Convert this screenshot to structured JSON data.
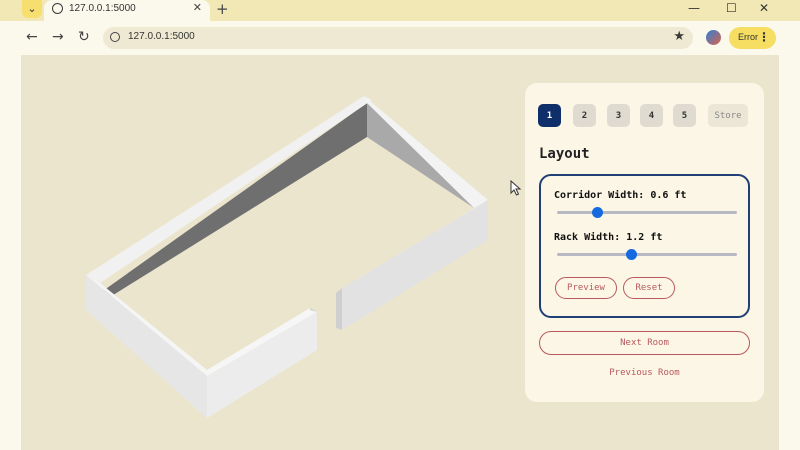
{
  "browser": {
    "tab_title": "127.0.0.1:5000",
    "tab_close": "✕",
    "new_tab": "+",
    "url": "127.0.0.1:5000",
    "error_label": "Error",
    "menu_glyph": "⋮",
    "back_glyph": "←",
    "forward_glyph": "→",
    "reload_glyph": "↻",
    "star_glyph": "★",
    "minimize_glyph": "—",
    "maximize_glyph": "☐",
    "close_glyph": "✕",
    "dropdown_glyph": "⌄"
  },
  "panel": {
    "steps": [
      "1",
      "2",
      "3",
      "4",
      "5"
    ],
    "active_step": "1",
    "store_label": "Store",
    "title": "Layout",
    "sliders": [
      {
        "label": "Corridor Width: 0.6 ft",
        "value_fraction": 0.22
      },
      {
        "label": "Rack Width: 1.2 ft",
        "value_fraction": 0.41
      }
    ],
    "preview_label": "Preview",
    "reset_label": "Reset",
    "next_label": "Next Room",
    "previous_label": "Previous Room"
  },
  "colors": {
    "background": "#ebe5cd",
    "panel": "#fbf6e6",
    "active_step": "#0f2f6a",
    "accent_red": "#b8585e",
    "slider_thumb": "#1769e0",
    "error_button": "#f6de62"
  }
}
